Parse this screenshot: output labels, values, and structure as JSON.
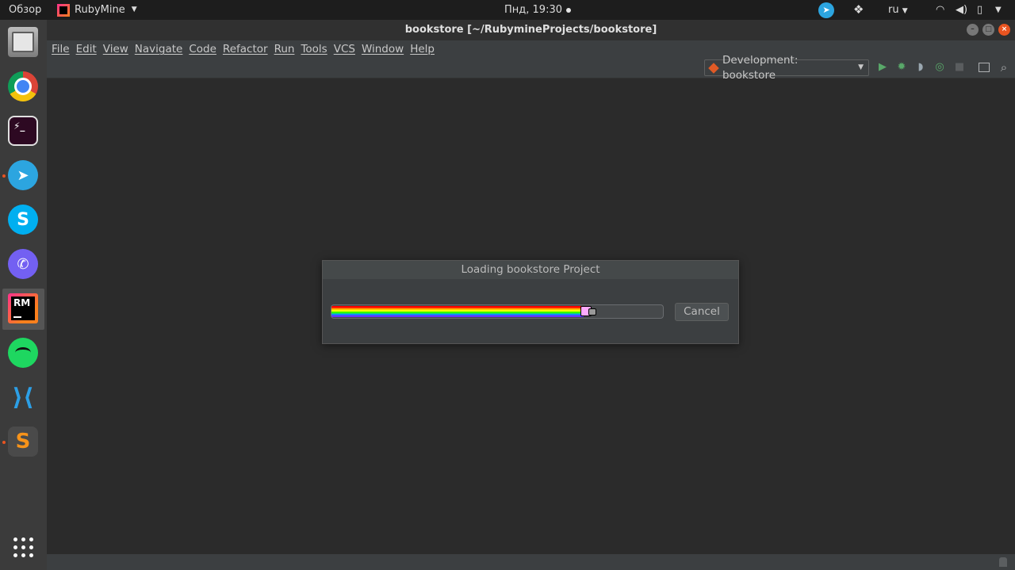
{
  "topbar": {
    "activities": "Обзор",
    "app_name": "RubyMine",
    "clock": "Пнд, 19:30",
    "language": "ru"
  },
  "window": {
    "title": "bookstore [~/RubymineProjects/bookstore]"
  },
  "menu": {
    "file": "File",
    "edit": "Edit",
    "view": "View",
    "navigate": "Navigate",
    "code": "Code",
    "refactor": "Refactor",
    "run": "Run",
    "tools": "Tools",
    "vcs": "VCS",
    "window": "Window",
    "help": "Help"
  },
  "toolbar": {
    "run_config": "Development: bookstore"
  },
  "dock": {
    "rubymine_label": "RM"
  },
  "dialog": {
    "title": "Loading bookstore Project",
    "progress_fraction": 0.76,
    "cancel_label": "Cancel"
  },
  "colors": {
    "accent": "#e95420",
    "ide_background": "#2b2b2b",
    "panel": "#3c3f41"
  },
  "icons": {
    "tray": [
      "telegram-icon",
      "dropbox-icon",
      "wifi-icon",
      "volume-icon",
      "battery-icon"
    ],
    "toolbar": [
      "run-icon",
      "debug-icon",
      "coverage-icon",
      "profile-icon",
      "stop-icon",
      "terminal-icon",
      "search-icon"
    ]
  }
}
